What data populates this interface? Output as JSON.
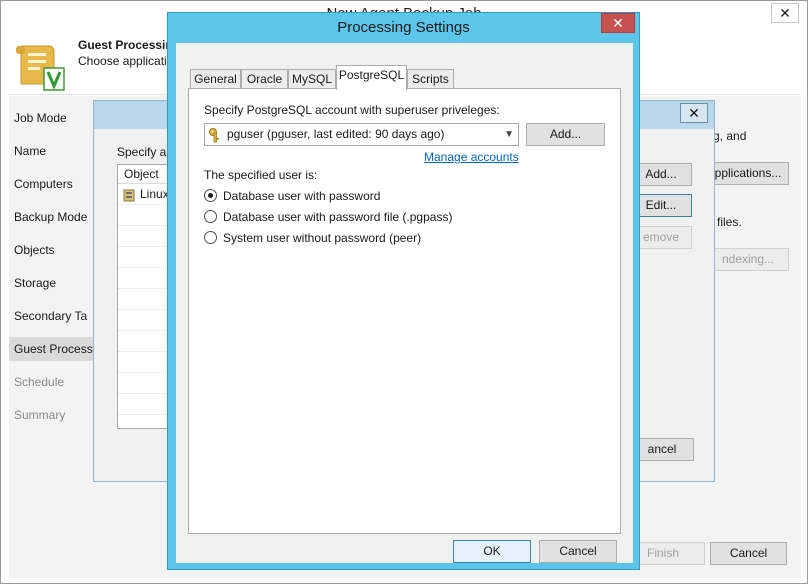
{
  "wizard": {
    "title": "New Agent Backup Job",
    "close_glyph": "✕",
    "header_title": "Guest Processing",
    "header_desc": "Choose applicatio",
    "nav": [
      {
        "label": "Job Mode",
        "enabled": true
      },
      {
        "label": "Name",
        "enabled": true
      },
      {
        "label": "Computers",
        "enabled": true
      },
      {
        "label": "Backup Mode",
        "enabled": true
      },
      {
        "label": "Objects",
        "enabled": true
      },
      {
        "label": "Storage",
        "enabled": true
      },
      {
        "label": "Secondary Ta",
        "enabled": true
      },
      {
        "label": "Guest Process",
        "enabled": true,
        "active": true
      },
      {
        "label": "Schedule",
        "enabled": false
      },
      {
        "label": "Summary",
        "enabled": false
      }
    ],
    "right_text_1": "g, and",
    "applications_button": "pplications...",
    "right_text_2": "files.",
    "indexing_button": "ndexing...",
    "finish_button": "Finish",
    "cancel_button": "Cancel"
  },
  "middle_dialog": {
    "close_glyph": "✕",
    "label": "Specify ap",
    "list_header": "Object",
    "list_item": "Linux",
    "add_button": "Add...",
    "edit_button": "Edit...",
    "remove_button": "emove",
    "cancel_button": "ancel"
  },
  "processing_settings": {
    "title": "Processing Settings",
    "close_glyph": "✕",
    "tabs": [
      "General",
      "Oracle",
      "MySQL",
      "PostgreSQL",
      "Scripts"
    ],
    "active_tab": "PostgreSQL",
    "account_label": "Specify PostgreSQL account with superuser priveleges:",
    "account_value": "pguser (pguser, last edited: 90 days ago)",
    "add_button": "Add...",
    "manage_link": "Manage accounts",
    "user_label": "The specified user is:",
    "options": [
      {
        "label": "Database user with password",
        "checked": true
      },
      {
        "label": "Database user with password file (.pgpass)",
        "checked": false
      },
      {
        "label": "System user without password (peer)",
        "checked": false
      }
    ],
    "ok_button": "OK",
    "cancel_button": "Cancel"
  },
  "colors": {
    "dialog_frame": "#5bc6ea",
    "close_red": "#c75050",
    "link": "#0066cc"
  }
}
